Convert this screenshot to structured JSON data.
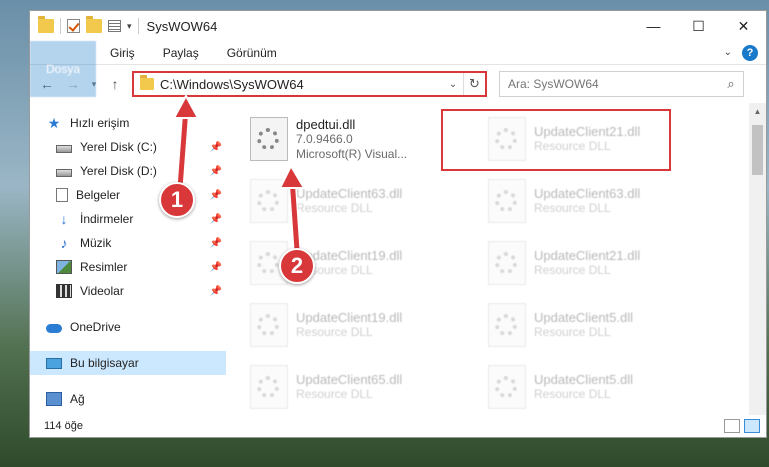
{
  "window": {
    "title": "SysWOW64",
    "controls": {
      "minimize": "—",
      "maximize": "☐",
      "close": "✕"
    }
  },
  "ribbon": {
    "tabs": [
      "Dosya",
      "Giriş",
      "Paylaş",
      "Görünüm"
    ],
    "expand_icon": "chevron-down-icon",
    "help": "?"
  },
  "address_bar": {
    "path": "C:\\Windows\\SysWOW64",
    "search_placeholder": "Ara: SysWOW64"
  },
  "nav_pane": {
    "quick_access": "Hızlı erişim",
    "items": [
      {
        "label": "Yerel Disk (C:)",
        "icon": "disk-icon",
        "pinned": true
      },
      {
        "label": "Yerel Disk (D:)",
        "icon": "disk-icon",
        "pinned": true
      },
      {
        "label": "Belgeler",
        "icon": "document-icon",
        "pinned": true
      },
      {
        "label": "İndirmeler",
        "icon": "download-icon",
        "pinned": true
      },
      {
        "label": "Müzik",
        "icon": "music-icon",
        "pinned": true
      },
      {
        "label": "Resimler",
        "icon": "pictures-icon",
        "pinned": true
      },
      {
        "label": "Videolar",
        "icon": "videos-icon",
        "pinned": true
      }
    ],
    "onedrive": "OneDrive",
    "this_pc": "Bu bilgisayar",
    "network": "Ağ"
  },
  "files": [
    {
      "name": "dpedtui.dll",
      "line2": "7.0.9466.0",
      "line3": "Microsoft(R) Visual...",
      "highlighted": true
    },
    {
      "name": "UpdateClient21.dll",
      "line2": "Resource DLL"
    },
    {
      "name": "UpdateClient63.dll",
      "line2": "Resource DLL"
    },
    {
      "name": "UpdateClient63.dll",
      "line2": "Resource DLL"
    },
    {
      "name": "UpdateClient19.dll",
      "line2": "Resource DLL"
    },
    {
      "name": "UpdateClient21.dll",
      "line2": "Resource DLL"
    },
    {
      "name": "UpdateClient19.dll",
      "line2": "Resource DLL"
    },
    {
      "name": "UpdateClient5.dll",
      "line2": "Resource DLL"
    },
    {
      "name": "UpdateClient65.dll",
      "line2": "Resource DLL"
    },
    {
      "name": "UpdateClient5.dll",
      "line2": "Resource DLL"
    }
  ],
  "status": {
    "item_count": "114 öğe"
  },
  "callouts": [
    "1",
    "2"
  ],
  "colors": {
    "accent": "#1979ca",
    "highlight": "#d9383a",
    "selected": "#cce8ff"
  }
}
